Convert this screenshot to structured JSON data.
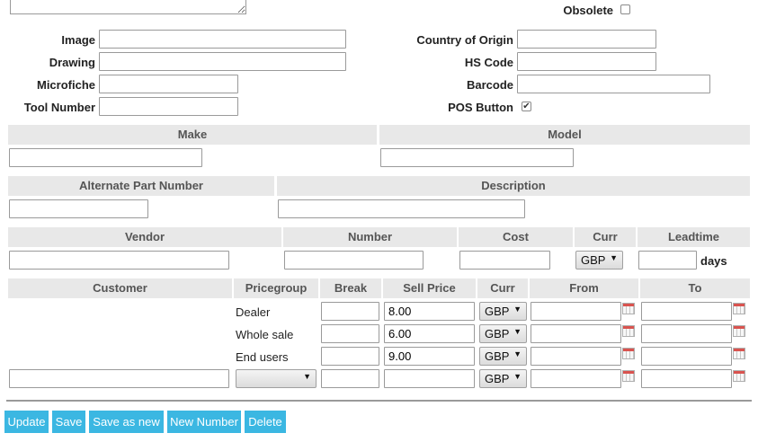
{
  "top": {
    "obsolete_label": "Obsolete",
    "image_label": "Image",
    "drawing_label": "Drawing",
    "microfiche_label": "Microfiche",
    "tool_number_label": "Tool Number",
    "country_label": "Country of Origin",
    "hs_code_label": "HS Code",
    "barcode_label": "Barcode",
    "pos_button_label": "POS Button",
    "obsolete_checked": false,
    "pos_button_checked": true
  },
  "make_model": {
    "make_header": "Make",
    "model_header": "Model"
  },
  "alt_desc": {
    "alt_part_header": "Alternate Part Number",
    "description_header": "Description"
  },
  "vendor": {
    "vendor_header": "Vendor",
    "number_header": "Number",
    "cost_header": "Cost",
    "curr_header": "Curr",
    "leadtime_header": "Leadtime",
    "currency_value": "GBP",
    "days_label": "days"
  },
  "pricing": {
    "headers": {
      "customer": "Customer",
      "pricegroup": "Pricegroup",
      "break": "Break",
      "sell_price": "Sell Price",
      "curr": "Curr",
      "from": "From",
      "to": "To"
    },
    "rows": [
      {
        "pricegroup": "Dealer",
        "sell_price": "8.00",
        "currency": "GBP"
      },
      {
        "pricegroup": "Whole sale",
        "sell_price": "6.00",
        "currency": "GBP"
      },
      {
        "pricegroup": "End users",
        "sell_price": "9.00",
        "currency": "GBP"
      }
    ],
    "new_row": {
      "pricegroup": "",
      "currency": "GBP"
    }
  },
  "buttons": {
    "update": "Update",
    "save": "Save",
    "save_as_new": "Save as new",
    "new_number": "New Number",
    "delete": "Delete"
  },
  "colors": {
    "button_bg": "#3bb7e2",
    "header_bg": "#e8e8e8"
  }
}
